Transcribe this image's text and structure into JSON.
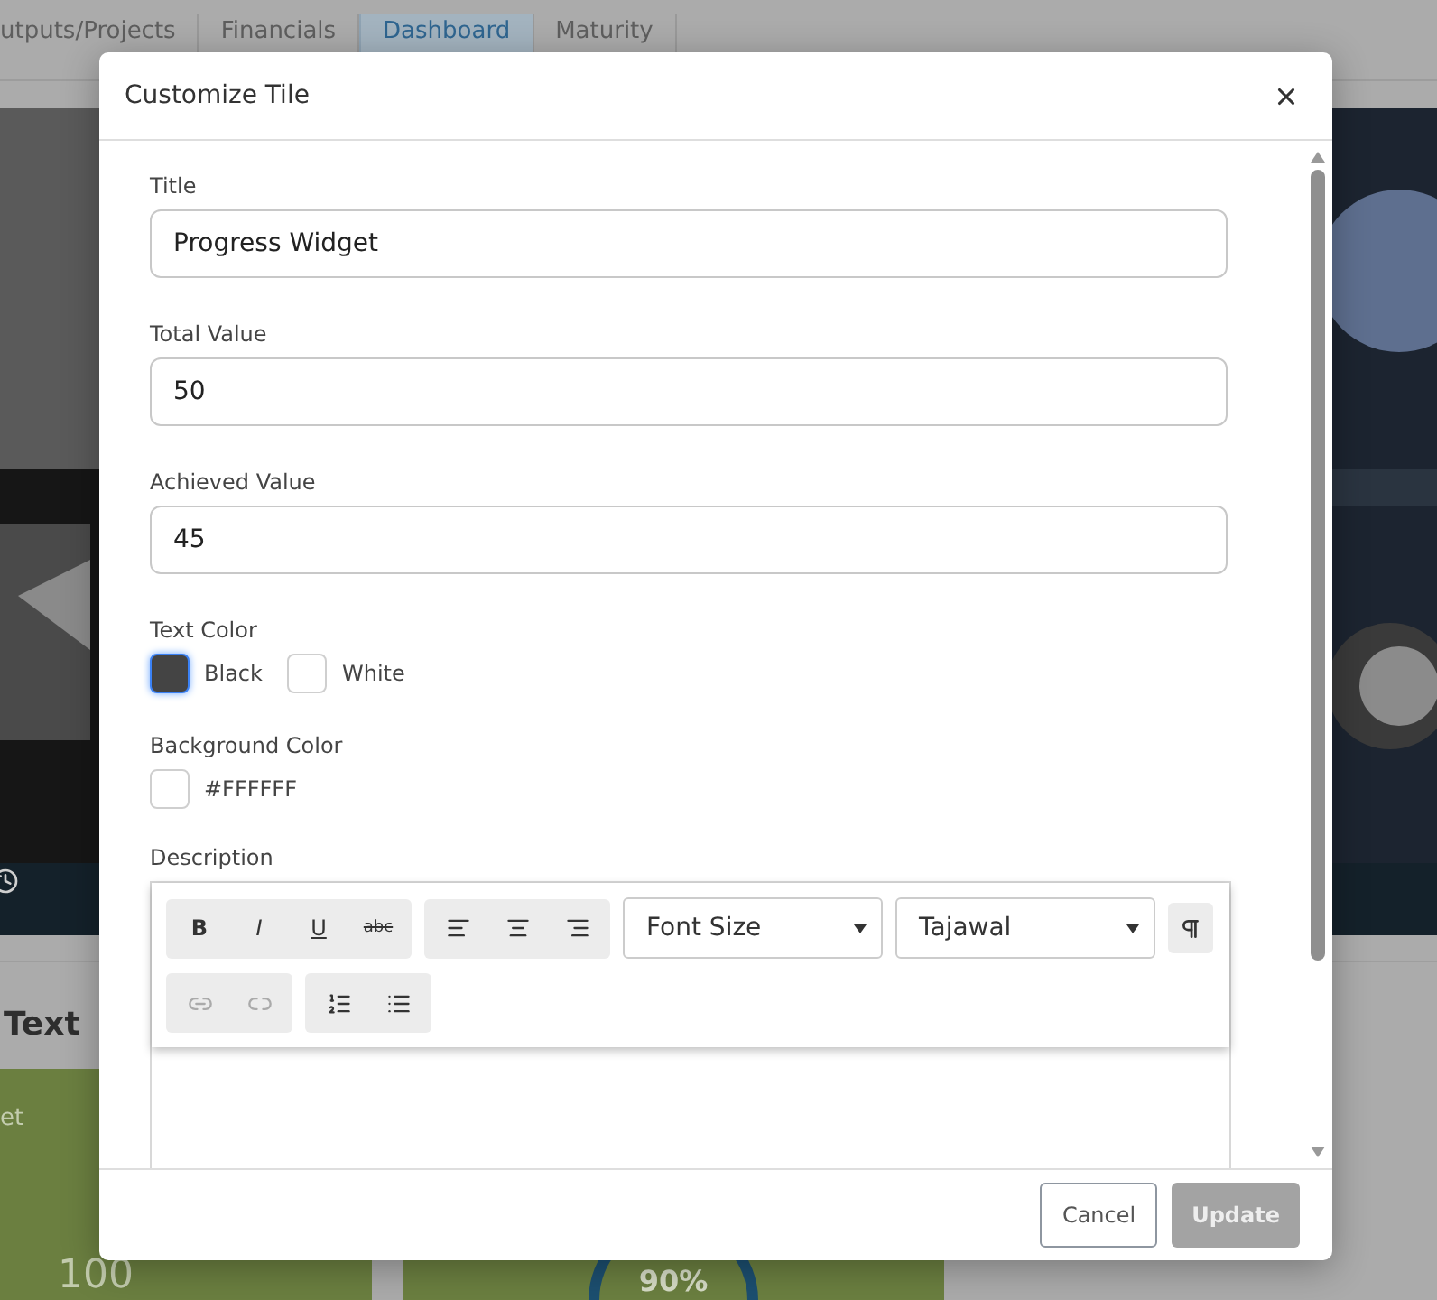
{
  "background": {
    "tabs": [
      {
        "label": "utputs/Projects",
        "selected": false
      },
      {
        "label": "Financials",
        "selected": false
      },
      {
        "label": "Dashboard",
        "selected": true
      },
      {
        "label": "Maturity",
        "selected": false
      }
    ],
    "section_heading": "Text",
    "tiles": [
      {
        "kind": "number",
        "label": "et",
        "value": "100"
      },
      {
        "kind": "donut",
        "value": "90%"
      }
    ]
  },
  "dialog": {
    "title": "Customize Tile",
    "fields": [
      {
        "label": "Title",
        "value": "Progress Widget"
      },
      {
        "label": "Total Value",
        "value": "50"
      },
      {
        "label": "Achieved Value",
        "value": "45"
      }
    ],
    "text_color": {
      "label": "Text Color",
      "options": [
        {
          "label": "Black",
          "color": "#444444",
          "selected": true
        },
        {
          "label": "White",
          "color": "#ffffff",
          "selected": false
        }
      ]
    },
    "background_color": {
      "label": "Background Color",
      "value": "#FFFFFF"
    },
    "description": {
      "label": "Description",
      "toolbar_rows": [
        [
          {
            "buttons": [
              {
                "kind": "bold",
                "label": "B",
                "disabled": false
              },
              {
                "kind": "italic",
                "label": "I",
                "disabled": false
              },
              {
                "kind": "underline",
                "label": "U",
                "disabled": false
              },
              {
                "kind": "strike",
                "label": "abc",
                "disabled": false
              }
            ]
          },
          {
            "buttons": [
              {
                "kind": "align-left",
                "disabled": false
              },
              {
                "kind": "align-center",
                "disabled": false
              },
              {
                "kind": "align-right",
                "disabled": false
              }
            ]
          },
          {
            "kind": "dropdown",
            "value": "Font Size"
          },
          {
            "kind": "dropdown",
            "value": "Tajawal"
          },
          {
            "kind": "rtl"
          }
        ],
        [
          {
            "buttons": [
              {
                "kind": "link",
                "disabled": true
              },
              {
                "kind": "unlink",
                "disabled": true
              }
            ]
          },
          {
            "buttons": [
              {
                "kind": "ordered-list",
                "disabled": false
              },
              {
                "kind": "bullet-list",
                "disabled": false
              }
            ]
          }
        ]
      ]
    },
    "buttons": [
      {
        "label": "Cancel",
        "kind": "secondary",
        "disabled": false
      },
      {
        "label": "Update",
        "kind": "primary",
        "disabled": true
      }
    ]
  }
}
